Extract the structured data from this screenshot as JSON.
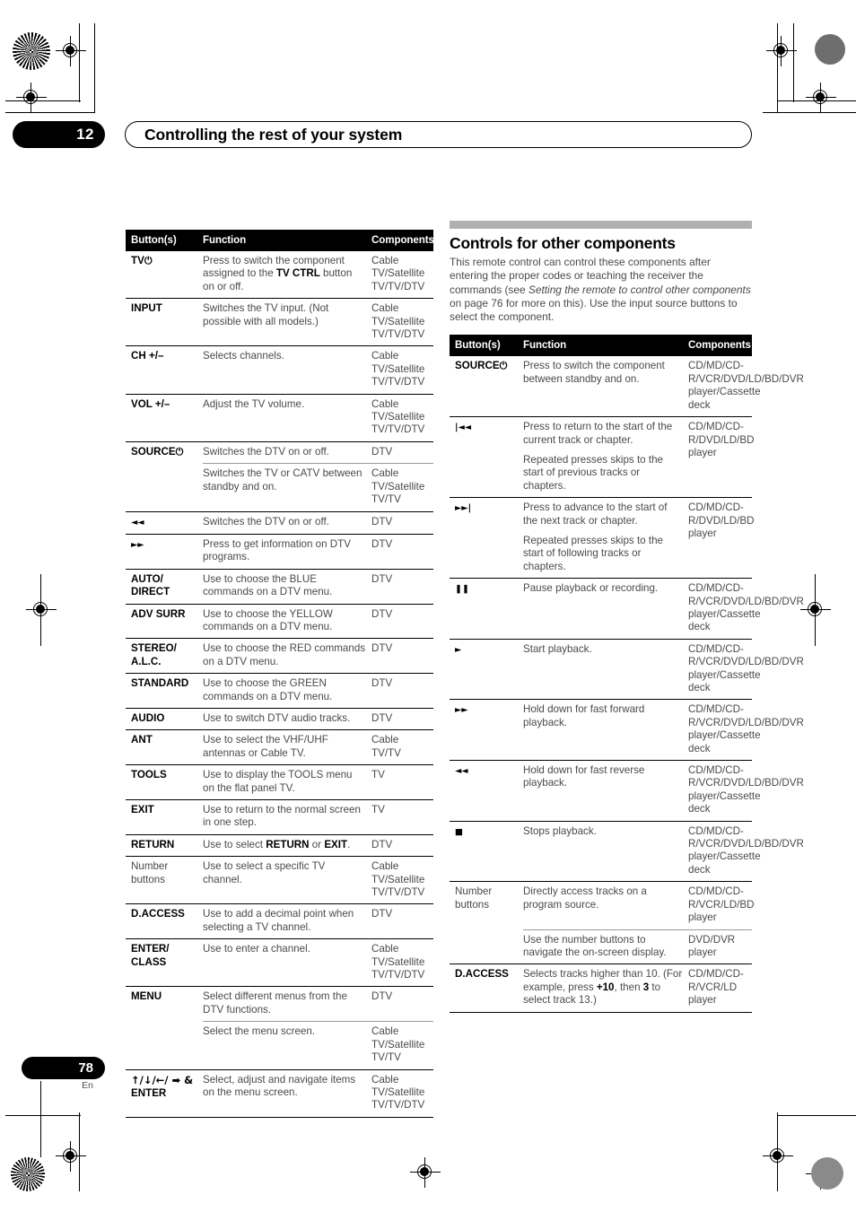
{
  "header": {
    "chapter_number": "12",
    "title": "Controlling the rest of your system"
  },
  "footer": {
    "page_number": "78",
    "language": "En"
  },
  "left_table": {
    "headers": {
      "buttons": "Button(s)",
      "function": "Function",
      "components": "Components"
    },
    "rows": [
      {
        "button": "TV",
        "button_glyph": "⏻",
        "function_pre": "Press to switch the component assigned to the ",
        "function_bold": "TV CTRL",
        "function_post": " button on or off.",
        "components": "Cable TV/Satellite TV/TV/DTV"
      },
      {
        "button": "INPUT",
        "function": "Switches the TV input. (Not possible with all models.)",
        "components": "Cable TV/Satellite TV/TV/DTV"
      },
      {
        "button": "CH +/–",
        "function": "Selects channels.",
        "components": "Cable TV/Satellite TV/TV/DTV"
      },
      {
        "button": "VOL +/–",
        "function": "Adjust the TV volume.",
        "components": "Cable TV/Satellite TV/TV/DTV"
      },
      {
        "button": "SOURCE",
        "button_glyph": "⏻",
        "function": "Switches the DTV on or off.",
        "components": "DTV",
        "sub": {
          "function": "Switches the TV or CATV between standby and on.",
          "components": "Cable TV/Satellite TV/TV"
        }
      },
      {
        "button_glyph_only": "◄◄",
        "function": "Switches the DTV on or off.",
        "components": "DTV"
      },
      {
        "button_glyph_only": "►►",
        "function": "Press to get information on DTV programs.",
        "components": "DTV"
      },
      {
        "button": "AUTO/ DIRECT",
        "function": "Use to choose the BLUE commands on a DTV menu.",
        "components": "DTV"
      },
      {
        "button": "ADV SURR",
        "function": "Use to choose the YELLOW commands on a DTV menu.",
        "components": "DTV"
      },
      {
        "button": "STEREO/ A.L.C.",
        "function": "Use to choose the RED commands on a DTV menu.",
        "components": "DTV"
      },
      {
        "button": "STANDARD",
        "function": "Use to choose the GREEN commands on a DTV menu.",
        "components": "DTV"
      },
      {
        "button": "AUDIO",
        "function": "Use to switch DTV audio tracks.",
        "components": "DTV"
      },
      {
        "button": "ANT",
        "function": "Use to select the VHF/UHF antennas or Cable TV.",
        "components": "Cable TV/TV"
      },
      {
        "button": "TOOLS",
        "function": "Use to display the TOOLS menu on the flat panel TV.",
        "components": "TV"
      },
      {
        "button": "EXIT",
        "function": "Use to return to the normal screen in one step.",
        "components": "TV"
      },
      {
        "button": "RETURN",
        "function_pre": "Use to select ",
        "function_bold": "RETURN",
        "function_mid": " or ",
        "function_bold2": "EXIT",
        "function_post": ".",
        "components": "DTV"
      },
      {
        "button_plain": "Number buttons",
        "function": "Use to select a specific TV channel.",
        "components": "Cable TV/Satellite TV/TV/DTV"
      },
      {
        "button": "D.ACCESS",
        "function": "Use to add a decimal point when selecting a TV channel.",
        "components": "DTV"
      },
      {
        "button": "ENTER/ CLASS",
        "function": "Use to enter a channel.",
        "components": "Cable TV/Satellite TV/TV/DTV"
      },
      {
        "button": "MENU",
        "function": "Select different menus from the DTV functions.",
        "components": "DTV",
        "sub": {
          "function": "Select the menu screen.",
          "components": "Cable TV/Satellite TV/TV"
        }
      },
      {
        "button_arrows": "↑/↓/←/ ➡ & ",
        "button_arrows_bold": "ENTER",
        "function": "Select, adjust and navigate items on the menu screen.",
        "components": "Cable TV/Satellite TV/TV/DTV"
      }
    ]
  },
  "right_section": {
    "title": "Controls for other components",
    "intro_pre": "This remote control can control these components after entering the proper codes or teaching the receiver the commands (see ",
    "intro_italic": "Setting the remote to control other components",
    "intro_post": " on page 76 for more on this). Use the input source buttons to select the component."
  },
  "right_table": {
    "headers": {
      "buttons": "Button(s)",
      "function": "Function",
      "components": "Components"
    },
    "rows": [
      {
        "button": "SOURCE",
        "button_glyph": "⏻",
        "function": "Press to switch the component between standby and on.",
        "components": "CD/MD/CD-R/VCR/DVD/LD/BD/DVR player/Cassette deck"
      },
      {
        "button_glyph_only": "|◄◄",
        "function": "Press to return to the start of the current track or chapter.",
        "function2": "Repeated presses skips to the start of previous tracks or chapters.",
        "components": "CD/MD/CD-R/DVD/LD/BD player"
      },
      {
        "button_glyph_only": "►►|",
        "function": "Press to advance to the start of the next track or chapter.",
        "function2": "Repeated presses skips to the start of following tracks or chapters.",
        "components": "CD/MD/CD-R/DVD/LD/BD player"
      },
      {
        "button_glyph_only": "❚❚",
        "function": "Pause playback or recording.",
        "components": "CD/MD/CD-R/VCR/DVD/LD/BD/DVR player/Cassette deck"
      },
      {
        "button_glyph_only": "►",
        "function": "Start playback.",
        "components": "CD/MD/CD-R/VCR/DVD/LD/BD/DVR player/Cassette deck"
      },
      {
        "button_glyph_only": "►►",
        "function": "Hold down for fast forward playback.",
        "components": "CD/MD/CD-R/VCR/DVD/LD/BD/DVR player/Cassette deck"
      },
      {
        "button_glyph_only": "◄◄",
        "function": "Hold down for fast reverse playback.",
        "components": "CD/MD/CD-R/VCR/DVD/LD/BD/DVR player/Cassette deck"
      },
      {
        "button_glyph_only": "■",
        "function": "Stops playback.",
        "components": "CD/MD/CD-R/VCR/DVD/LD/BD/DVR player/Cassette deck"
      },
      {
        "button_plain": "Number buttons",
        "function": "Directly access tracks on a program source.",
        "components": "CD/MD/CD-R/VCR/LD/BD player",
        "sub": {
          "function": "Use the number buttons to navigate the on-screen display.",
          "components": "DVD/DVR player"
        }
      },
      {
        "button": "D.ACCESS",
        "function_pre": "Selects tracks higher than 10. (For example, press ",
        "function_bold": "+10",
        "function_mid": ", then ",
        "function_bold2": "3",
        "function_post": " to select track 13.)",
        "components": "CD/MD/CD-R/VCR/LD player"
      }
    ]
  }
}
